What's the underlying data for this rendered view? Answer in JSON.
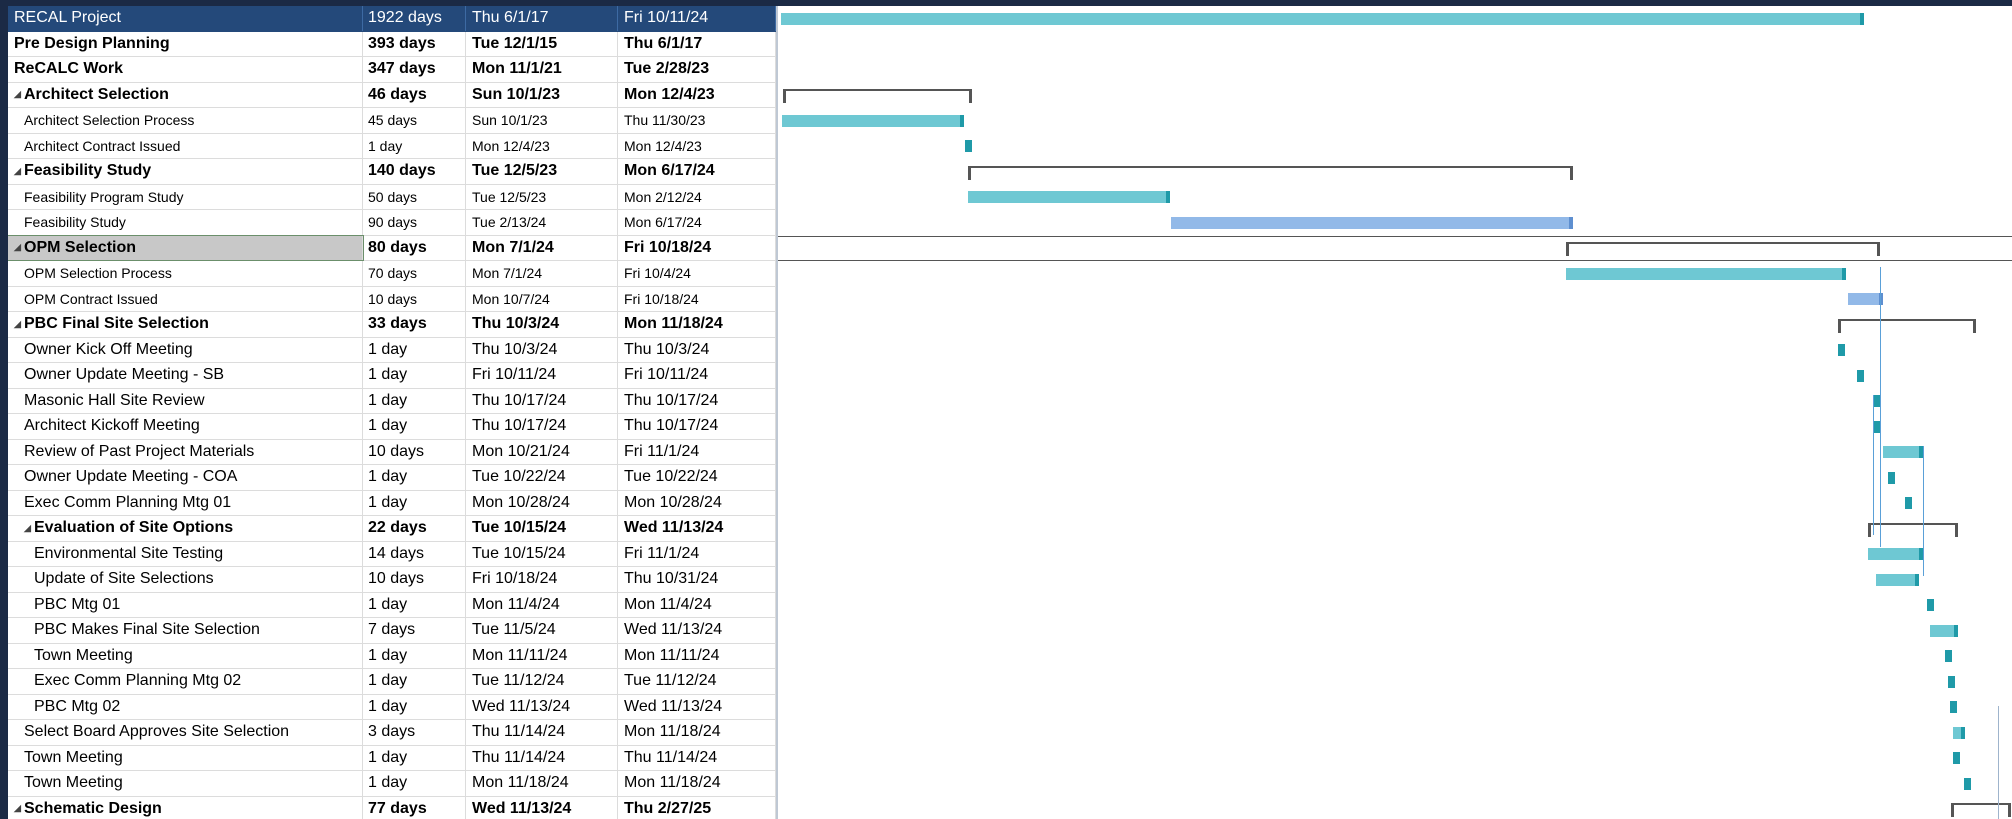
{
  "tasks": [
    {
      "name": "RECAL Project",
      "duration": "1922 days",
      "start": "Thu 6/1/17",
      "finish": "Fri 10/11/24",
      "style": "first",
      "indent": 0,
      "collapse": false
    },
    {
      "name": "Pre Design Planning",
      "duration": "393 days",
      "start": "Tue 12/1/15",
      "finish": "Thu 6/1/17",
      "style": "b",
      "indent": 0,
      "collapse": false
    },
    {
      "name": "ReCALC Work",
      "duration": "347 days",
      "start": "Mon 11/1/21",
      "finish": "Tue 2/28/23",
      "style": "b",
      "indent": 0,
      "collapse": false
    },
    {
      "name": "Architect Selection",
      "duration": "46 days",
      "start": "Sun 10/1/23",
      "finish": "Mon 12/4/23",
      "style": "b",
      "indent": 0,
      "collapse": true
    },
    {
      "name": "Architect Selection Process",
      "duration": "45 days",
      "start": "Sun 10/1/23",
      "finish": "Thu 11/30/23",
      "style": "s",
      "indent": 1,
      "collapse": false
    },
    {
      "name": "Architect Contract Issued",
      "duration": "1 day",
      "start": "Mon 12/4/23",
      "finish": "Mon 12/4/23",
      "style": "s",
      "indent": 1,
      "collapse": false
    },
    {
      "name": "Feasibility Study",
      "duration": "140 days",
      "start": "Tue 12/5/23",
      "finish": "Mon 6/17/24",
      "style": "b",
      "indent": 0,
      "collapse": true
    },
    {
      "name": "Feasibility Program Study",
      "duration": "50 days",
      "start": "Tue 12/5/23",
      "finish": "Mon 2/12/24",
      "style": "s",
      "indent": 1,
      "collapse": false
    },
    {
      "name": "Feasibility Study",
      "duration": "90 days",
      "start": "Tue 2/13/24",
      "finish": "Mon 6/17/24",
      "style": "s",
      "indent": 1,
      "collapse": false
    },
    {
      "name": "OPM Selection",
      "duration": "80 days",
      "start": "Mon 7/1/24",
      "finish": "Fri 10/18/24",
      "style": "b sel",
      "indent": 0,
      "collapse": true
    },
    {
      "name": "OPM Selection Process",
      "duration": "70 days",
      "start": "Mon 7/1/24",
      "finish": "Fri 10/4/24",
      "style": "s",
      "indent": 1,
      "collapse": false
    },
    {
      "name": "OPM Contract Issued",
      "duration": "10 days",
      "start": "Mon 10/7/24",
      "finish": "Fri 10/18/24",
      "style": "s",
      "indent": 1,
      "collapse": false
    },
    {
      "name": "PBC Final Site Selection",
      "duration": "33 days",
      "start": "Thu 10/3/24",
      "finish": "Mon 11/18/24",
      "style": "b",
      "indent": 0,
      "collapse": true
    },
    {
      "name": "Owner Kick Off Meeting",
      "duration": "1 day",
      "start": "Thu 10/3/24",
      "finish": "Thu 10/3/24",
      "style": "",
      "indent": 1,
      "collapse": false
    },
    {
      "name": "Owner Update Meeting - SB",
      "duration": "1 day",
      "start": "Fri 10/11/24",
      "finish": "Fri 10/11/24",
      "style": "",
      "indent": 1,
      "collapse": false
    },
    {
      "name": "Masonic Hall Site Review",
      "duration": "1 day",
      "start": "Thu 10/17/24",
      "finish": "Thu 10/17/24",
      "style": "",
      "indent": 1,
      "collapse": false
    },
    {
      "name": "Architect Kickoff Meeting",
      "duration": "1 day",
      "start": "Thu 10/17/24",
      "finish": "Thu 10/17/24",
      "style": "",
      "indent": 1,
      "collapse": false
    },
    {
      "name": "Review of Past Project Materials",
      "duration": "10 days",
      "start": "Mon 10/21/24",
      "finish": "Fri 11/1/24",
      "style": "",
      "indent": 1,
      "collapse": false
    },
    {
      "name": "Owner Update Meeting - COA",
      "duration": "1 day",
      "start": "Tue 10/22/24",
      "finish": "Tue 10/22/24",
      "style": "",
      "indent": 1,
      "collapse": false
    },
    {
      "name": "Exec Comm Planning Mtg 01",
      "duration": "1 day",
      "start": "Mon 10/28/24",
      "finish": "Mon 10/28/24",
      "style": "",
      "indent": 1,
      "collapse": false
    },
    {
      "name": "Evaluation of Site Options",
      "duration": "22 days",
      "start": "Tue 10/15/24",
      "finish": "Wed 11/13/24",
      "style": "b",
      "indent": 1,
      "collapse": true
    },
    {
      "name": "Environmental Site Testing",
      "duration": "14 days",
      "start": "Tue 10/15/24",
      "finish": "Fri 11/1/24",
      "style": "",
      "indent": 2,
      "collapse": false
    },
    {
      "name": "Update of Site Selections",
      "duration": "10 days",
      "start": "Fri 10/18/24",
      "finish": "Thu 10/31/24",
      "style": "",
      "indent": 2,
      "collapse": false
    },
    {
      "name": "PBC Mtg 01",
      "duration": "1 day",
      "start": "Mon 11/4/24",
      "finish": "Mon 11/4/24",
      "style": "",
      "indent": 2,
      "collapse": false
    },
    {
      "name": "PBC Makes Final Site Selection",
      "duration": "7 days",
      "start": "Tue 11/5/24",
      "finish": "Wed 11/13/24",
      "style": "",
      "indent": 2,
      "collapse": false
    },
    {
      "name": "Town Meeting",
      "duration": "1 day",
      "start": "Mon 11/11/24",
      "finish": "Mon 11/11/24",
      "style": "",
      "indent": 2,
      "collapse": false
    },
    {
      "name": "Exec Comm Planning Mtg 02",
      "duration": "1 day",
      "start": "Tue 11/12/24",
      "finish": "Tue 11/12/24",
      "style": "",
      "indent": 2,
      "collapse": false
    },
    {
      "name": "PBC Mtg 02",
      "duration": "1 day",
      "start": "Wed 11/13/24",
      "finish": "Wed 11/13/24",
      "style": "",
      "indent": 2,
      "collapse": false
    },
    {
      "name": "Select Board Approves Site Selection",
      "duration": "3 days",
      "start": "Thu 11/14/24",
      "finish": "Mon 11/18/24",
      "style": "",
      "indent": 1,
      "collapse": false
    },
    {
      "name": "Town Meeting",
      "duration": "1 day",
      "start": "Thu 11/14/24",
      "finish": "Thu 11/14/24",
      "style": "",
      "indent": 1,
      "collapse": false
    },
    {
      "name": "Town Meeting",
      "duration": "1 day",
      "start": "Mon 11/18/24",
      "finish": "Mon 11/18/24",
      "style": "",
      "indent": 1,
      "collapse": false
    },
    {
      "name": "Schematic Design",
      "duration": "77 days",
      "start": "Wed 11/13/24",
      "finish": "Thu 2/27/25",
      "style": "b",
      "indent": 0,
      "collapse": true
    }
  ]
}
